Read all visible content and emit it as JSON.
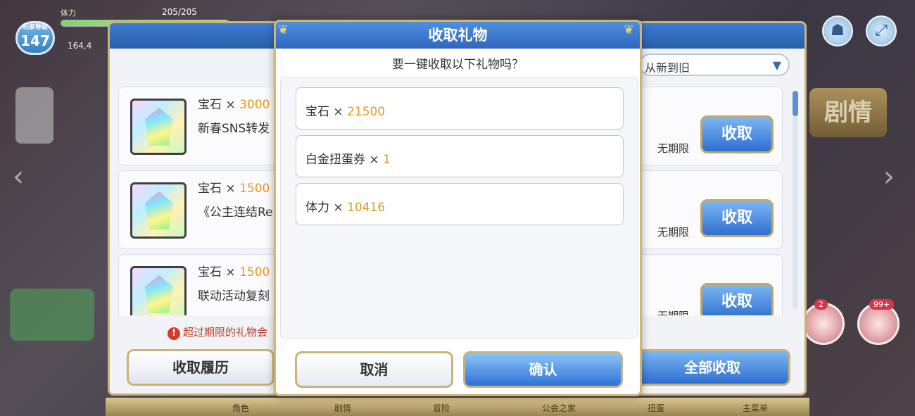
{
  "hud": {
    "level_caption": "玩家等级",
    "level": "147",
    "stamina_label": "体力",
    "stamina": "205/205",
    "sub_value": "164,4"
  },
  "background_panel": {
    "sort_label": "从新到旧",
    "items": [
      {
        "name": "宝石",
        "times": "×",
        "amount": "3000",
        "desc": "新春SNS转发",
        "expire": "无期限",
        "claim_label": "收取"
      },
      {
        "name": "宝石",
        "times": "×",
        "amount": "1500",
        "desc": "《公主连结Re",
        "expire": "无期限",
        "claim_label": "收取"
      },
      {
        "name": "宝石",
        "times": "×",
        "amount": "1500",
        "desc": "联动活动复刻",
        "expire": "无期限",
        "claim_label": "收取"
      }
    ],
    "warning": "超过期限的礼物会",
    "history_label": "收取履历",
    "claim_all_label": "全部收取"
  },
  "side": {
    "story_label": "剧情",
    "badge_left": "2",
    "badge_right": "99+"
  },
  "bottom_nav": [
    "角色",
    "剧情",
    "冒险",
    "公会之家",
    "扭蛋",
    "主菜单"
  ],
  "modal": {
    "title": "收取礼物",
    "question": "要一键收取以下礼物吗？",
    "items": [
      {
        "name": "宝石",
        "times": "×",
        "amount": "21500"
      },
      {
        "name": "白金扭蛋券",
        "times": "×",
        "amount": "1"
      },
      {
        "name": "体力",
        "times": "×",
        "amount": "10416"
      }
    ],
    "cancel_label": "取消",
    "confirm_label": "确认"
  },
  "colors": {
    "accent_blue": "#2f66bd",
    "gold_border": "#d2b56b",
    "amount_orange": "#e09b1f"
  },
  "icons": [
    "gem-icon",
    "expand-icon",
    "character-icon",
    "chevron-left-icon",
    "chevron-right-icon",
    "warning-icon",
    "gift-icon"
  ]
}
